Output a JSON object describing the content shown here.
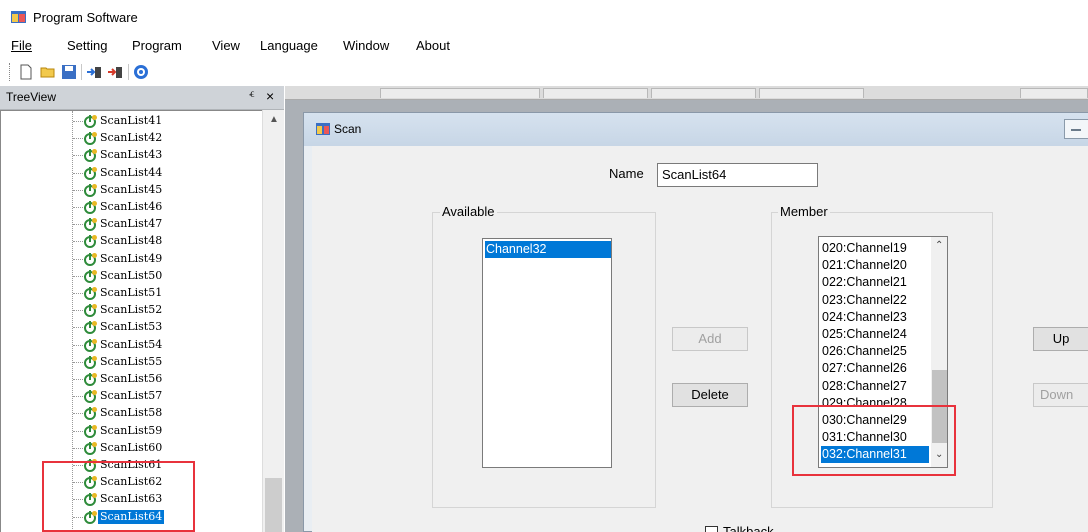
{
  "app": {
    "title": "Program Software"
  },
  "menu": [
    "File",
    "Setting",
    "Program",
    "View",
    "Language",
    "Window",
    "About"
  ],
  "toolbar": {
    "icons": [
      "new-file-icon",
      "open-folder-icon",
      "save-icon",
      "read-radio-icon",
      "write-radio-icon",
      "help-icon"
    ]
  },
  "treeview": {
    "title": "TreeView",
    "pin_glyph": "ⱔ",
    "close_glyph": "×",
    "items": [
      "ScanList41",
      "ScanList42",
      "ScanList43",
      "ScanList44",
      "ScanList45",
      "ScanList46",
      "ScanList47",
      "ScanList48",
      "ScanList49",
      "ScanList50",
      "ScanList51",
      "ScanList52",
      "ScanList53",
      "ScanList54",
      "ScanList55",
      "ScanList56",
      "ScanList57",
      "ScanList58",
      "ScanList59",
      "ScanList60",
      "ScanList61",
      "ScanList62",
      "ScanList63",
      "ScanList64"
    ],
    "selected": "ScanList64"
  },
  "scan_window": {
    "title": "Scan",
    "name_label": "Name",
    "name_value": "ScanList64",
    "available": {
      "label": "Available",
      "items": [
        "Channel32"
      ],
      "selected": "Channel32"
    },
    "member": {
      "label": "Member",
      "items": [
        "020:Channel19",
        "021:Channel20",
        "022:Channel21",
        "023:Channel22",
        "024:Channel23",
        "025:Channel24",
        "026:Channel25",
        "027:Channel26",
        "028:Channel27",
        "029:Channel28",
        "030:Channel29",
        "031:Channel30",
        "032:Channel31"
      ],
      "selected": "032:Channel31"
    },
    "buttons": {
      "add": "Add",
      "delete": "Delete",
      "up": "Up",
      "down": "Down"
    },
    "talkback_label": "Talkback"
  },
  "colors": {
    "selection": "#0078d7",
    "highlight_box": "#e8323c"
  }
}
